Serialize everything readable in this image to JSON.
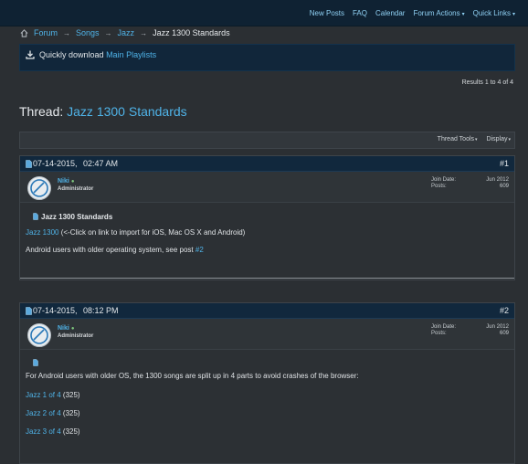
{
  "topnav": {
    "items": [
      "New Posts",
      "FAQ",
      "Calendar",
      "Forum Actions",
      "Quick Links"
    ]
  },
  "breadcrumb": {
    "items": [
      "Forum",
      "Songs",
      "Jazz"
    ],
    "current": "Jazz 1300 Standards"
  },
  "notice": {
    "prefix": "Quickly download",
    "link": "Main Playlists"
  },
  "results": "Results 1 to 4 of 4",
  "thread": {
    "prefix": "Thread:",
    "name": "Jazz 1300 Standards"
  },
  "toolbar": {
    "thread_tools": "Thread Tools",
    "display": "Display"
  },
  "posts": [
    {
      "date": "07-14-2015,",
      "time": "02:47 AM",
      "number": "#1",
      "user": "Niki",
      "role": "Administrator",
      "join_label": "Join Date:",
      "join_value": "Jun 2012",
      "posts_label": "Posts:",
      "posts_value": "609",
      "title": "Jazz 1300 Standards",
      "line1_link": "Jazz 1300",
      "line1_text": "(<-Click on link to import for iOS, Mac OS X and Android)",
      "line2_text": "Android users with older operating system, see post",
      "line2_link": "#2"
    },
    {
      "date": "07-14-2015,",
      "time": "08:12 PM",
      "number": "#2",
      "user": "Niki",
      "role": "Administrator",
      "join_label": "Join Date:",
      "join_value": "Jun 2012",
      "posts_label": "Posts:",
      "posts_value": "609",
      "body": "For Android users with older OS, the 1300 songs are split up in 4 parts to avoid crashes of the browser:",
      "parts": [
        {
          "link": "Jazz 1 of 4",
          "count": "(325)"
        },
        {
          "link": "Jazz 2 of 4",
          "count": "(325)"
        },
        {
          "link": "Jazz 3 of 4",
          "count": "(325)"
        }
      ]
    }
  ],
  "colors": {
    "link": "#4fb3e8",
    "nav_bg": "#0f2233",
    "page_bg": "#2b2f33",
    "post_head_bg": "#11283d"
  }
}
